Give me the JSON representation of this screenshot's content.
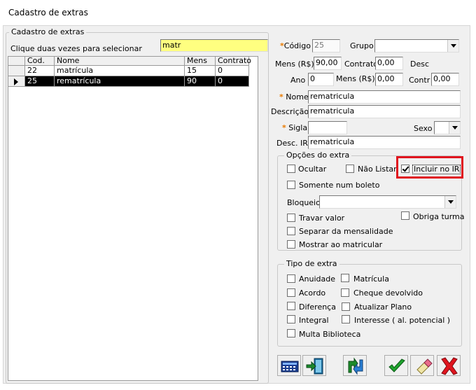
{
  "window": {
    "title": "Cadastro de extras"
  },
  "list": {
    "group_label": "Cadastro de extras",
    "hint": "Clique duas vezes para selecionar",
    "search_value": "matr",
    "columns": [
      "Cod.",
      "Nome",
      "Mens",
      "Contrato"
    ],
    "rows": [
      [
        "22",
        "matrícula",
        "15",
        "0"
      ],
      [
        "25",
        "rematrícula",
        "90",
        "0"
      ]
    ]
  },
  "form": {
    "codigo_label": "Código",
    "codigo_value": "25",
    "grupo_label": "Grupo",
    "grupo_value": "",
    "mens_label": "Mens (R$)",
    "mens_value": "90,00",
    "contrato_label": "Contrato",
    "contrato_value": "0,00",
    "desc_label": "Desc",
    "ano_label": "Ano",
    "ano_value": "0",
    "mens2_label": "Mens (R$)",
    "mens2_value": "0,00",
    "contr_label": "Contr",
    "contr_value": "0,00",
    "nome_label": "Nome",
    "nome_value": "rematricula",
    "descricao_label": "Descrição",
    "descricao_value": "rematricula",
    "sigla_label": "Sigla",
    "sigla_value": "",
    "sexo_label": "Sexo",
    "sexo_value": "",
    "descir_label": "Desc. IR",
    "descir_value": "rematricula"
  },
  "options": {
    "group_label": "Opções do extra",
    "ocultar": "Ocultar",
    "nao_listar": "Não Listar",
    "incluir_ir": "Incluir no IR",
    "somente_boleto": "Somente num boleto",
    "bloqueio_label": "Bloqueio",
    "bloqueio_value": "",
    "travar_valor": "Travar valor",
    "obriga_turma": "Obriga turma",
    "separar": "Separar da mensalidade",
    "mostrar": "Mostrar ao matricular",
    "highlight_color": "#e0141e"
  },
  "tipo": {
    "group_label": "Tipo de extra",
    "anuidade": "Anuidade",
    "matricula": "Matrícula",
    "acordo": "Acordo",
    "cheque": "Cheque devolvido",
    "diferenca": "Diferença",
    "atualizar": "Atualizar Plano",
    "integral": "Integral",
    "interesse": "Interesse ( al. potencial )",
    "multa": "Multa Biblioteca"
  },
  "toolbar": {
    "icons": [
      "calculator-icon",
      "exit-door-icon",
      "swap-arrows-icon",
      "confirm-check-icon",
      "eraser-icon",
      "cancel-x-icon"
    ]
  }
}
